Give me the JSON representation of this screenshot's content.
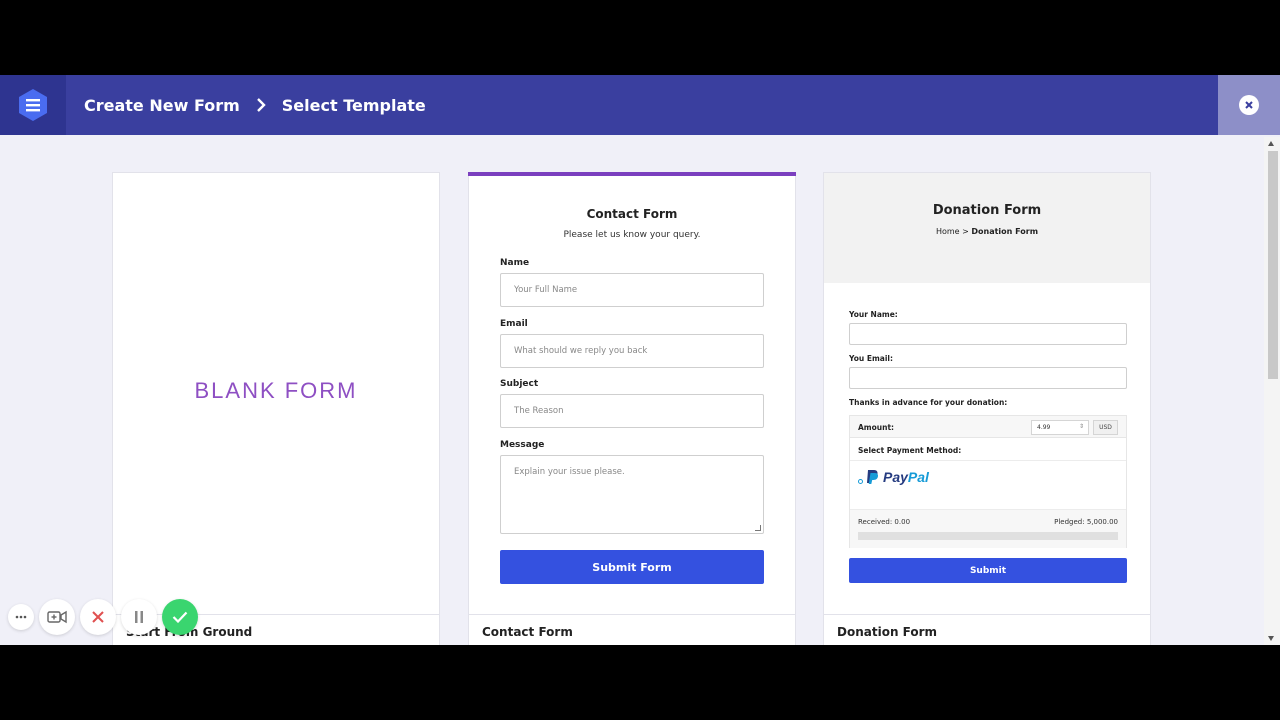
{
  "topbar": {
    "crumb_1": "Create New Form",
    "crumb_2": "Select Template",
    "brand_icon": "hexagon-menu-icon",
    "close_icon": "close-circle-icon"
  },
  "cards": {
    "blank": {
      "wordmark": "BLANK FORM",
      "footer": "Start From Ground"
    },
    "contact": {
      "title": "Contact Form",
      "subtitle": "Please let us know your query.",
      "fields": [
        {
          "label": "Name",
          "placeholder": "Your Full Name"
        },
        {
          "label": "Email",
          "placeholder": "What should we reply you back"
        },
        {
          "label": "Subject",
          "placeholder": "The Reason"
        },
        {
          "label": "Message",
          "placeholder": "Explain your issue please."
        }
      ],
      "submit": "Submit Form",
      "footer": "Contact Form"
    },
    "donation": {
      "title": "Donation Form",
      "crumb_home": "Home",
      "crumb_sep": ">",
      "crumb_current": "Donation Form",
      "name_label": "Your Name:",
      "email_label": "You Email:",
      "thanks": "Thanks in advance for your donation:",
      "amount_label": "Amount:",
      "amount_value": "4.99",
      "currency": "USD",
      "payment_label": "Select Payment Method:",
      "paypal_a": "Pay",
      "paypal_b": "Pal",
      "received": "Received: 0.00",
      "pledged": "Pledged: 5,000.00",
      "progress_fraction": 0,
      "submit": "Submit",
      "footer": "Donation Form"
    }
  },
  "recorder": {
    "icons": [
      "more-icon",
      "camera-add-icon",
      "cancel-icon",
      "pause-icon",
      "check-icon"
    ]
  },
  "colors": {
    "topbar": "#3a3f9f",
    "accent": "#7b3fbf",
    "button": "#3451e0"
  }
}
